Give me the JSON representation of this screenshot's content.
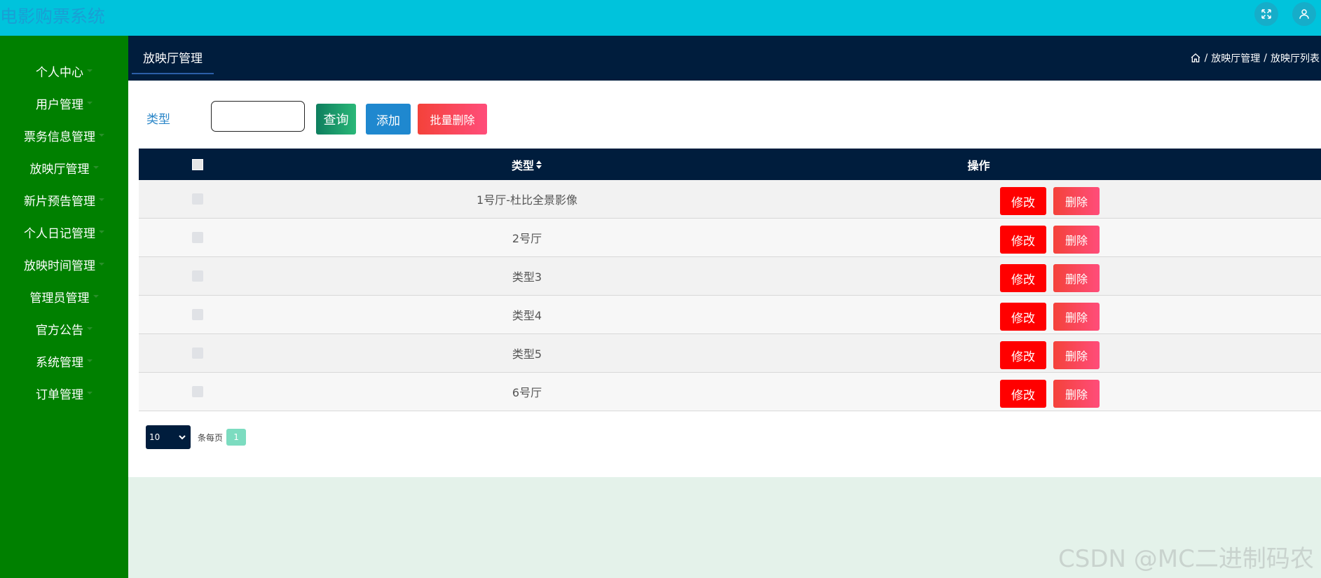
{
  "app": {
    "title": "电影购票系统"
  },
  "sidebar": {
    "items": [
      {
        "label": "个人中心"
      },
      {
        "label": "用户管理"
      },
      {
        "label": "票务信息管理"
      },
      {
        "label": "放映厅管理"
      },
      {
        "label": "新片预告管理"
      },
      {
        "label": "个人日记管理"
      },
      {
        "label": "放映时间管理"
      },
      {
        "label": "管理员管理"
      },
      {
        "label": "官方公告"
      },
      {
        "label": "系统管理"
      },
      {
        "label": "订单管理"
      }
    ]
  },
  "header": {
    "tab": "放映厅管理",
    "breadcrumb": {
      "separator": "/",
      "section": "放映厅管理",
      "page": "放映厅列表"
    }
  },
  "search": {
    "label": "类型",
    "value": "",
    "query_label": "查询",
    "add_label": "添加",
    "batch_delete_label": "批量删除"
  },
  "table": {
    "columns": {
      "type": "类型",
      "actions": "操作"
    },
    "rows": [
      {
        "type": "1号厅-杜比全景影像",
        "edit": "修改",
        "delete": "删除"
      },
      {
        "type": "2号厅",
        "edit": "修改",
        "delete": "删除"
      },
      {
        "type": "类型3",
        "edit": "修改",
        "delete": "删除"
      },
      {
        "type": "类型4",
        "edit": "修改",
        "delete": "删除"
      },
      {
        "type": "类型5",
        "edit": "修改",
        "delete": "删除"
      },
      {
        "type": "6号厅",
        "edit": "修改",
        "delete": "删除"
      }
    ]
  },
  "pagination": {
    "page_size": "10",
    "per_page_label": "条每页",
    "current_page": "1"
  },
  "watermark": "CSDN @MC二进制码农",
  "colors": {
    "topbar": "#00c3dc",
    "sidebar": "#008000",
    "header": "#001d3d",
    "edit_button": "#ff0000",
    "add_button": "#1f88cf"
  },
  "icons": {
    "fullscreen": "expand-icon",
    "user": "user-icon",
    "home": "home-icon",
    "sort": "sort-icon",
    "dropdown": "chevron-down-icon"
  }
}
